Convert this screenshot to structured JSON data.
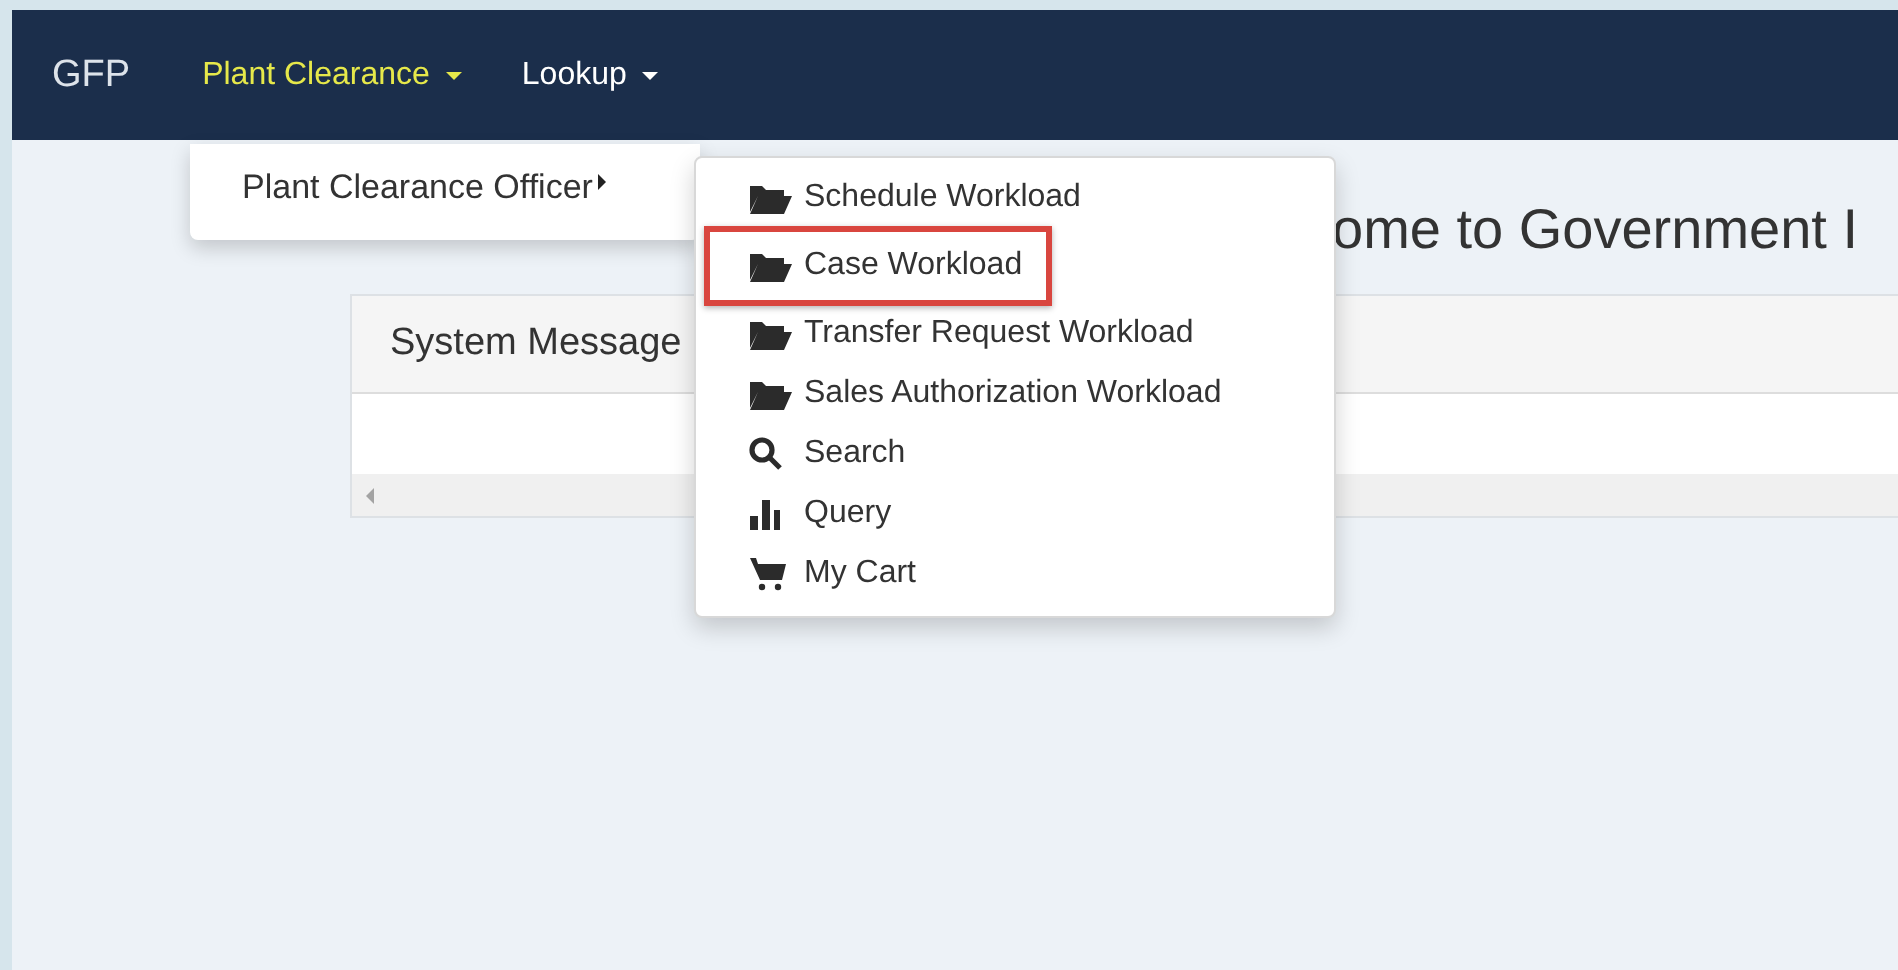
{
  "navbar": {
    "brand": "GFP",
    "items": [
      {
        "label": "Plant Clearance",
        "selected": true
      },
      {
        "label": "Lookup",
        "selected": false
      }
    ]
  },
  "dropdown": {
    "items": [
      {
        "label": "Plant Clearance Officer",
        "has_submenu": true
      }
    ]
  },
  "submenu": {
    "items": [
      {
        "kind": "workload",
        "label": "Schedule Workload",
        "highlighted": false
      },
      {
        "kind": "workload",
        "label": "Case Workload",
        "highlighted": true
      },
      {
        "kind": "workload",
        "label": "Transfer Request Workload",
        "highlighted": false
      },
      {
        "kind": "workload",
        "label": "Sales Authorization Workload",
        "highlighted": false
      },
      {
        "kind": "search",
        "label": "Search",
        "highlighted": false
      },
      {
        "kind": "query",
        "label": "Query",
        "highlighted": false
      },
      {
        "kind": "cart",
        "label": "My Cart",
        "highlighted": false
      }
    ]
  },
  "heading": "ome to Government I",
  "panel": {
    "title": "System Message"
  }
}
